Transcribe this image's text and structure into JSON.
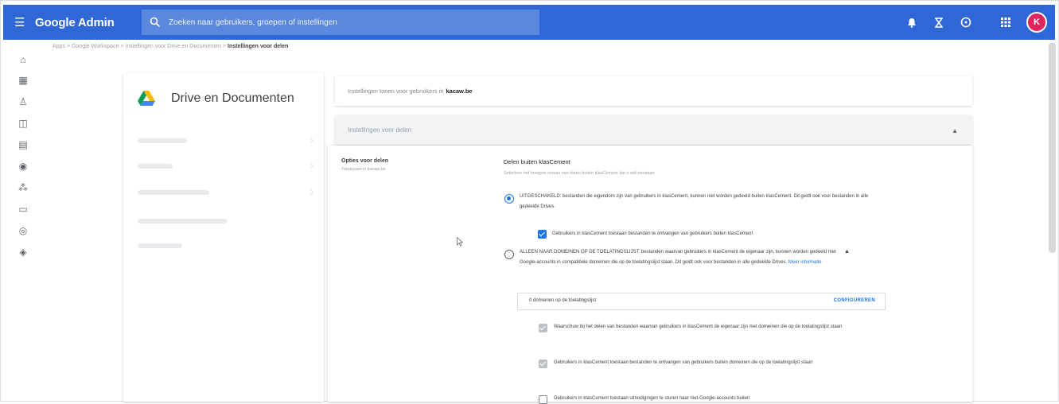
{
  "topbar": {
    "app_name": "Google Admin",
    "search_placeholder": "Zoeken naar gebruikers, groepen of instellingen",
    "avatar_initial": "K",
    "icons": [
      "menu-icon",
      "bell-icon",
      "hourglass-icon",
      "help-icon",
      "apps-grid-icon",
      "avatar"
    ],
    "accent_color": "#3067d6"
  },
  "rail": {
    "icons": [
      "home-icon",
      "dashboard-icon",
      "users-icon",
      "groups-icon",
      "buildings-icon",
      "devices-icon",
      "apps-icon",
      "billing-icon",
      "account-icon",
      "security-icon"
    ]
  },
  "breadcrumb": {
    "part1": "Apps",
    "part2": "Google Workspace",
    "part3": "Instellingen voor Drive en Documenten",
    "current": "Instellingen voor delen",
    "separator": ">"
  },
  "left_panel": {
    "title": "Drive en Documenten"
  },
  "settings_scope": {
    "prefix": "Instellingen tonen voor gebruikers in",
    "domain": "kacaw.be"
  },
  "section_header": {
    "label": "Instellingen voor delen"
  },
  "options": {
    "title": "Opties voor delen",
    "subtitle": "Toegepast in kacaw.be",
    "sharing_title": "Delen buiten klasCement",
    "sharing_subtitle": "Selecteer het hoogste niveau van delen buiten klasCement dat u wilt toestaan",
    "radio1_text": "UITGESCHAKELD: bestanden die eigendom zijn van gebruikers in klasCement, kunnen niet worden gedeeld buiten klasCement. Dit geldt ook voor bestanden in alle gedeelde Drives.",
    "checkbox1_text": "Gebruikers in klasCement toestaan bestanden te ontvangen van gebruikers buiten klasCement",
    "radio2_text": "ALLEEN NAAR DOMEINEN OP DE TOELATINGSLIJST: bestanden waarvan gebruikers in klasCement de eigenaar zijn, kunnen worden gedeeld met Google-accounts in compatibele domeinen die op de toelatingslijst staan. Dit geldt ook voor bestanden in alle gedeelde Drives.",
    "learn_more": "Meer informatie",
    "allowlist_text": "0 domeinen op de toelatingslijst",
    "allowlist_button": "CONFIGUREREN",
    "checkbox2_text": "Waarschuw bij het delen van bestanden waarvan gebruikers in klasCement de eigenaar zijn met domeinen die op de toelatingslijst staan",
    "checkbox3_text": "Gebruikers in klasCement toestaan bestanden te ontvangen van gebruikers buiten domeinen die op de toelatingslijst staan",
    "checkbox4_text": "Gebruikers in klasCement toestaan uitnodigingen te sturen naar niet-Google-accounts buiten"
  }
}
